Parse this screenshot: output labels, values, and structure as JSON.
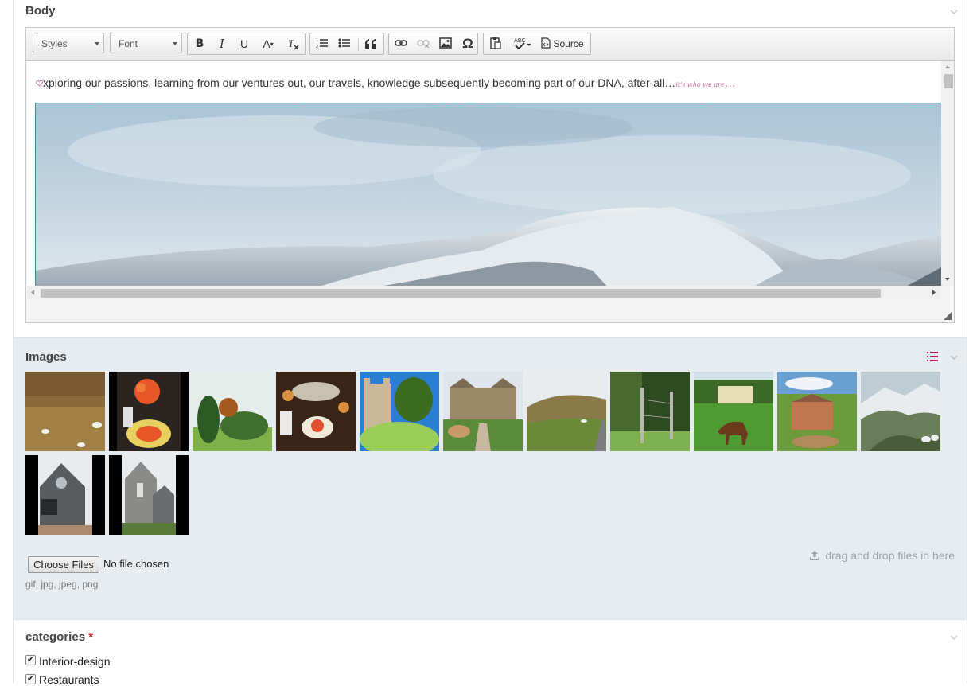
{
  "body_section": {
    "title": "Body",
    "toolbar": {
      "styles_label": "Styles",
      "font_label": "Font",
      "bold": "B",
      "italic": "I",
      "underline": "U",
      "text_color": "A",
      "remove_format": "Tx",
      "blockquote": "99",
      "special_char": "Ω",
      "source_label": "Source"
    },
    "content": {
      "intro_text": "xploring our passions, learning from our ventures out, our travels, knowledge subsequently becoming part of our DNA, after-all…",
      "intro_script": "it's who we are",
      "intro_dots": "…"
    }
  },
  "images_section": {
    "title": "Images",
    "thumbnails": [
      {
        "name": "moorland-sheep"
      },
      {
        "name": "table-orange-flowers"
      },
      {
        "name": "topiary-garden"
      },
      {
        "name": "dining-table"
      },
      {
        "name": "castle-topiary"
      },
      {
        "name": "manor-garden-path"
      },
      {
        "name": "highland-road"
      },
      {
        "name": "fenced-forest"
      },
      {
        "name": "horse-grazing"
      },
      {
        "name": "estate-aerial"
      },
      {
        "name": "mountain-sheep-painting"
      },
      {
        "name": "church-front"
      },
      {
        "name": "church-side"
      }
    ],
    "choose_files_label": "Choose Files",
    "no_file_text": "No file chosen",
    "allowed_types": "gif, jpg, jpeg, png",
    "dropzone_text": "drag and drop files in here"
  },
  "categories_section": {
    "title": "categories",
    "required_marker": "*",
    "items": [
      {
        "label": "Interior-design",
        "checked": true
      },
      {
        "label": "Restaurants",
        "checked": true
      }
    ]
  },
  "colors": {
    "accent_pink": "#c4185c",
    "panel_gray": "#e7ecf0",
    "frame_teal": "#3d8f8a"
  }
}
